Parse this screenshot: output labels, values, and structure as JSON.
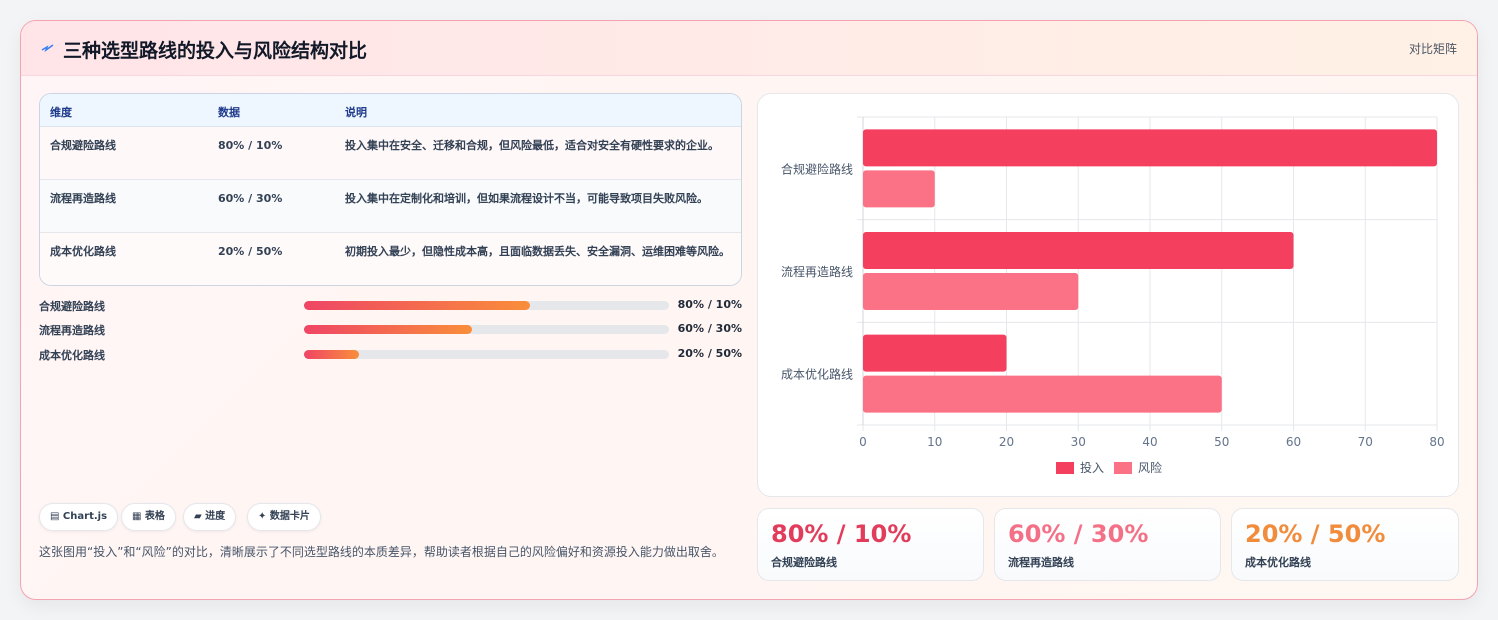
{
  "header": {
    "title": "三种选型路线的投入与风险结构对比",
    "right_label": "对比矩阵"
  },
  "table": {
    "headers": [
      "维度",
      "数据",
      "说明"
    ],
    "rows": [
      {
        "name": "合规避险路线",
        "data": "80% / 10%",
        "desc": "投入集中在安全、迁移和合规，但风险最低，适合对安全有硬性要求的企业。"
      },
      {
        "name": "流程再造路线",
        "data": "60% / 30%",
        "desc": "投入集中在定制化和培训，但如果流程设计不当，可能导致项目失败风险。"
      },
      {
        "name": "成本优化路线",
        "data": "20% / 50%",
        "desc": "初期投入最少，但隐性成本高，且面临数据丢失、安全漏洞、运维困难等风险。"
      }
    ]
  },
  "progress": [
    {
      "label": "合规避险路线",
      "value_text": "80% / 10%",
      "fill": 0.62
    },
    {
      "label": "流程再造路线",
      "value_text": "60% / 30%",
      "fill": 0.46
    },
    {
      "label": "成本优化路线",
      "value_text": "20% / 50%",
      "fill": 0.15
    }
  ],
  "tags": [
    "▤ Chart.js",
    "▦ 表格",
    "▰ 进度",
    "✦ 数据卡片"
  ],
  "description": "这张图用“投入”和“风险”的对比，清晰展示了不同选型路线的本质差异，帮助读者根据自己的风险偏好和资源投入能力做出取舍。",
  "stats": [
    {
      "value": "80% / 10%",
      "label": "合规避险路线",
      "color": "#e23c5c"
    },
    {
      "value": "60% / 30%",
      "label": "流程再造路线",
      "color": "#f47086"
    },
    {
      "value": "20% / 50%",
      "label": "成本优化路线",
      "color": "#f08c3c"
    }
  ],
  "chart_data": {
    "type": "bar",
    "orientation": "horizontal",
    "categories": [
      "合规避险路线",
      "流程再造路线",
      "成本优化路线"
    ],
    "series": [
      {
        "name": "投入",
        "values": [
          80,
          60,
          20
        ],
        "color": "#f43f5e"
      },
      {
        "name": "风险",
        "values": [
          10,
          30,
          50
        ],
        "color": "#fb7185"
      }
    ],
    "xlim": [
      0,
      80
    ],
    "ticks": [
      0,
      10,
      20,
      30,
      40,
      50,
      60,
      70,
      80
    ],
    "grid": true,
    "legend": "bottom"
  }
}
